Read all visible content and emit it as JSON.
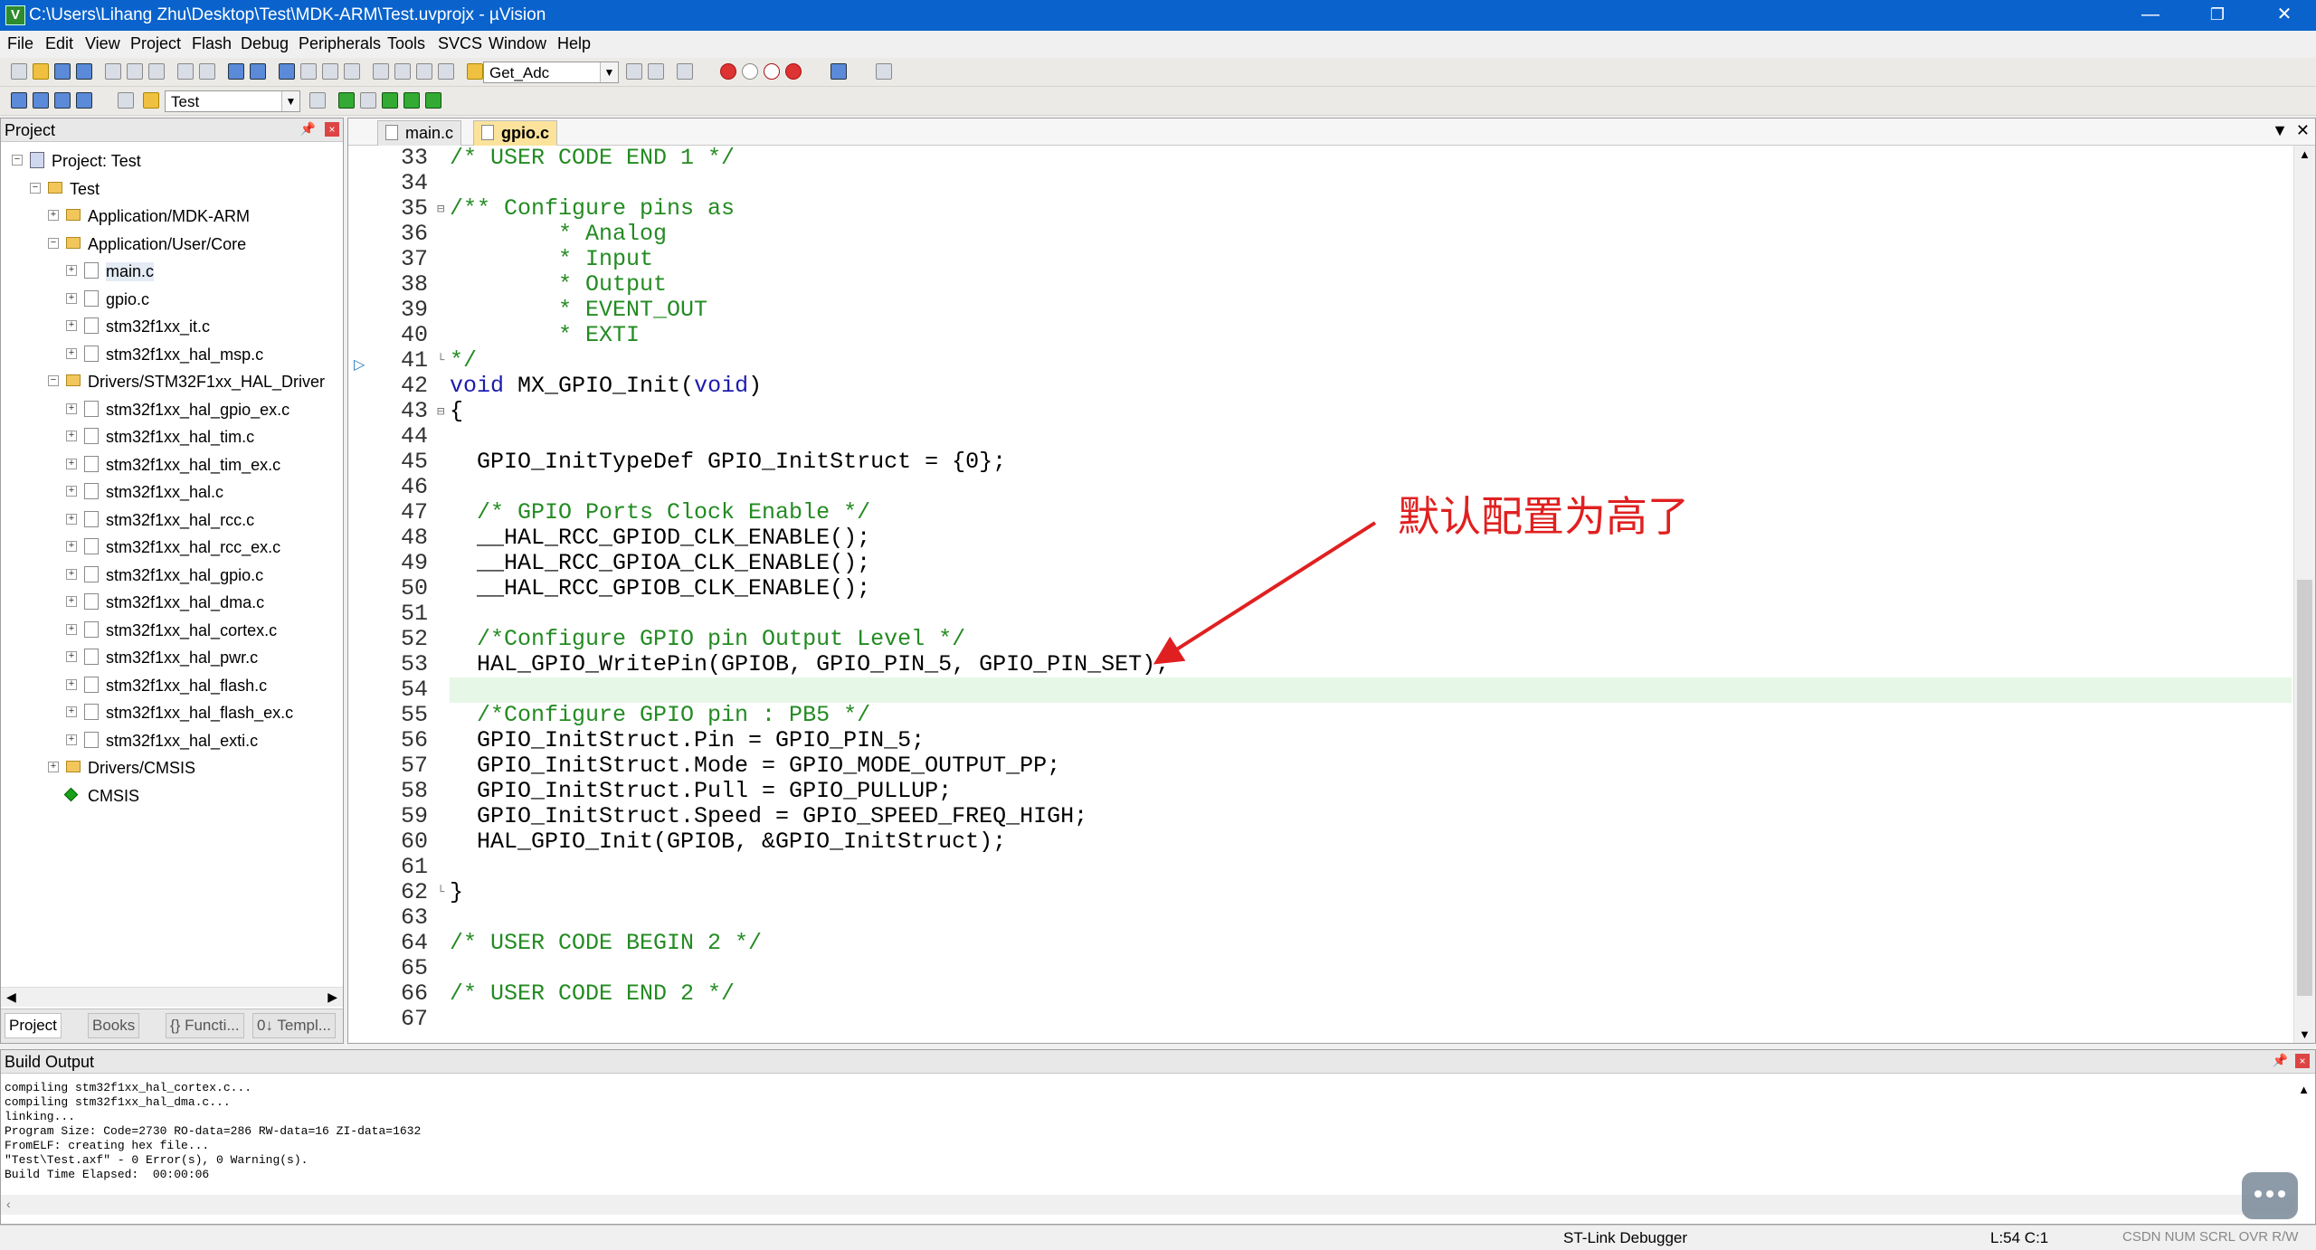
{
  "window": {
    "title": "C:\\Users\\Lihang Zhu\\Desktop\\Test\\MDK-ARM\\Test.uvprojx - µVision",
    "minimize": "—",
    "restore": "❐",
    "close": "✕"
  },
  "menu": [
    "File",
    "Edit",
    "View",
    "Project",
    "Flash",
    "Debug",
    "Peripherals",
    "Tools",
    "SVCS",
    "Window",
    "Help"
  ],
  "toolbar1": {
    "find_combo": "Get_Adc"
  },
  "toolbar2": {
    "target_combo": "Test"
  },
  "project_panel": {
    "title": "Project",
    "tree": [
      {
        "label": "Project: Test",
        "icon": "project-icon"
      },
      {
        "label": "Test",
        "icon": "folder-icon"
      },
      {
        "label": "Application/MDK-ARM",
        "icon": "folder-icon"
      },
      {
        "label": "Application/User/Core",
        "icon": "folder-icon"
      },
      {
        "label": "main.c",
        "icon": "file-icon"
      },
      {
        "label": "gpio.c",
        "icon": "file-icon"
      },
      {
        "label": "stm32f1xx_it.c",
        "icon": "file-icon"
      },
      {
        "label": "stm32f1xx_hal_msp.c",
        "icon": "file-icon"
      },
      {
        "label": "Drivers/STM32F1xx_HAL_Driver",
        "icon": "folder-icon"
      },
      {
        "label": "stm32f1xx_hal_gpio_ex.c",
        "icon": "file-icon"
      },
      {
        "label": "stm32f1xx_hal_tim.c",
        "icon": "file-icon"
      },
      {
        "label": "stm32f1xx_hal_tim_ex.c",
        "icon": "file-icon"
      },
      {
        "label": "stm32f1xx_hal.c",
        "icon": "file-icon"
      },
      {
        "label": "stm32f1xx_hal_rcc.c",
        "icon": "file-icon"
      },
      {
        "label": "stm32f1xx_hal_rcc_ex.c",
        "icon": "file-icon"
      },
      {
        "label": "stm32f1xx_hal_gpio.c",
        "icon": "file-icon"
      },
      {
        "label": "stm32f1xx_hal_dma.c",
        "icon": "file-icon"
      },
      {
        "label": "stm32f1xx_hal_cortex.c",
        "icon": "file-icon"
      },
      {
        "label": "stm32f1xx_hal_pwr.c",
        "icon": "file-icon"
      },
      {
        "label": "stm32f1xx_hal_flash.c",
        "icon": "file-icon"
      },
      {
        "label": "stm32f1xx_hal_flash_ex.c",
        "icon": "file-icon"
      },
      {
        "label": "stm32f1xx_hal_exti.c",
        "icon": "file-icon"
      },
      {
        "label": "Drivers/CMSIS",
        "icon": "folder-icon"
      },
      {
        "label": "CMSIS",
        "icon": "gem-icon"
      }
    ],
    "tabs": [
      "Project",
      "Books",
      "{} Functi...",
      "0↓ Templ..."
    ]
  },
  "editor": {
    "tabs": [
      {
        "label": "main.c",
        "active": false
      },
      {
        "label": "gpio.c",
        "active": true
      }
    ],
    "line_numbers": [
      "33",
      "34",
      "35",
      "36",
      "37",
      "38",
      "39",
      "40",
      "41",
      "42",
      "43",
      "44",
      "45",
      "46",
      "47",
      "48",
      "49",
      "50",
      "51",
      "52",
      "53",
      "54",
      "55",
      "56",
      "57",
      "58",
      "59",
      "60",
      "61",
      "62",
      "63",
      "64",
      "65",
      "66",
      "67"
    ],
    "code_lines": [
      "/* USER CODE END 1 */",
      "",
      "/** Configure pins as",
      "        * Analog",
      "        * Input",
      "        * Output",
      "        * EVENT_OUT",
      "        * EXTI",
      "*/",
      "void MX_GPIO_Init(void)",
      "{",
      "",
      "  GPIO_InitTypeDef GPIO_InitStruct = {0};",
      "",
      "  /* GPIO Ports Clock Enable */",
      "  __HAL_RCC_GPIOD_CLK_ENABLE();",
      "  __HAL_RCC_GPIOA_CLK_ENABLE();",
      "  __HAL_RCC_GPIOB_CLK_ENABLE();",
      "",
      "  /*Configure GPIO pin Output Level */",
      "  HAL_GPIO_WritePin(GPIOB, GPIO_PIN_5, GPIO_PIN_SET);",
      "",
      "  /*Configure GPIO pin : PB5 */",
      "  GPIO_InitStruct.Pin = GPIO_PIN_5;",
      "  GPIO_InitStruct.Mode = GPIO_MODE_OUTPUT_PP;",
      "  GPIO_InitStruct.Pull = GPIO_PULLUP;",
      "  GPIO_InitStruct.Speed = GPIO_SPEED_FREQ_HIGH;",
      "  HAL_GPIO_Init(GPIOB, &GPIO_InitStruct);",
      "",
      "}",
      "",
      "/* USER CODE BEGIN 2 */",
      "",
      "/* USER CODE END 2 */",
      ""
    ],
    "current_line": 54,
    "annotation": "默认配置为高了"
  },
  "build_output": {
    "title": "Build Output",
    "lines": [
      "compiling stm32f1xx_hal_cortex.c...",
      "compiling stm32f1xx_hal_dma.c...",
      "linking...",
      "Program Size: Code=2730 RO-data=286 RW-data=16 ZI-data=1632",
      "FromELF: creating hex file...",
      "\"Test\\Test.axf\" - 0 Error(s), 0 Warning(s).",
      "Build Time Elapsed:  00:00:06"
    ]
  },
  "status": {
    "debugger": "ST-Link Debugger",
    "position": "L:54 C:1",
    "caps": "CSDN  NUM  SCRL  OVR  R/W"
  },
  "colors": {
    "titlebar": "#0a63cc",
    "comment": "#238b22",
    "keyword": "#1c1cb0",
    "current_line": "#e7f7e7",
    "annotation": "#e02020",
    "active_tab": "#fce39b"
  }
}
